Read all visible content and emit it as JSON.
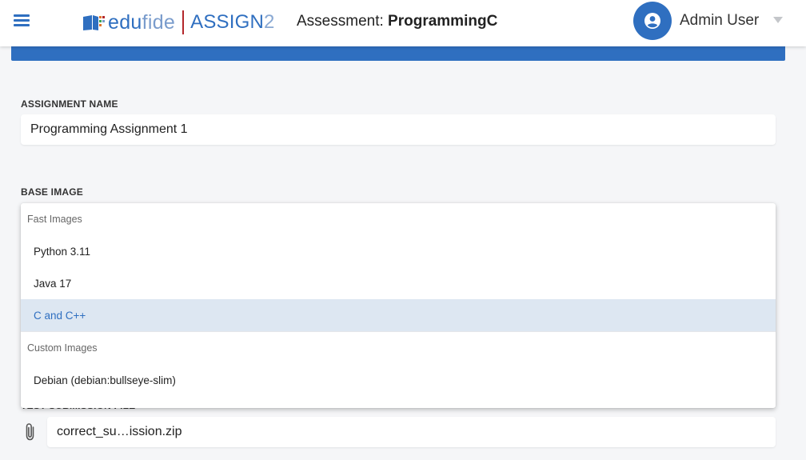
{
  "header": {
    "logo_edu": "edu",
    "logo_fide": "fide",
    "logo_assign": "ASSIGN",
    "logo_two": "2",
    "assessment_label": "Assessment:",
    "assessment_name": "ProgrammingC",
    "user_name": "Admin User"
  },
  "form": {
    "assignment_name_label": "ASSIGNMENT NAME",
    "assignment_name_value": "Programming Assignment 1",
    "base_image_label": "BASE IMAGE",
    "test_submission_label": "TEST SUBMISSION FILE",
    "test_submission_value": "correct_su…ission.zip"
  },
  "dropdown": {
    "group_fast": "Fast Images",
    "group_custom": "Custom Images",
    "options": [
      {
        "label": "Python 3.11"
      },
      {
        "label": "Java 17"
      },
      {
        "label": "C and C++"
      },
      {
        "label": "Debian (debian:bullseye-slim)"
      }
    ],
    "selected": "C and C++"
  },
  "colors": {
    "accent": "#2f6fc0",
    "brand_red": "#b3272b",
    "selected_bg": "#dde7f2"
  },
  "icons": [
    "menu-icon",
    "book-logo-icon",
    "user-circle-icon",
    "chevron-down-icon",
    "paperclip-icon"
  ]
}
